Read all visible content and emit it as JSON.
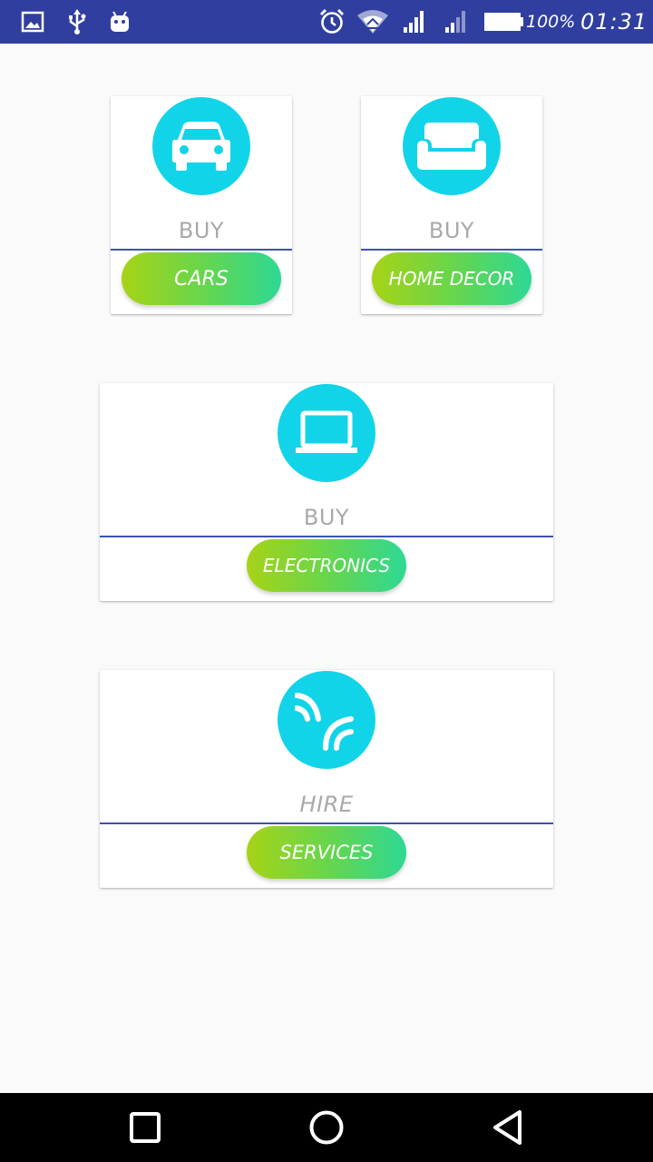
{
  "status_bar": {
    "battery_text": "100%",
    "time": "01:31",
    "icons": [
      "image-icon",
      "usb-icon",
      "android-icon",
      "alarm-icon",
      "wifi-icon",
      "signal-icon",
      "signal-icon",
      "battery-icon"
    ]
  },
  "cards": [
    {
      "icon": "car-icon",
      "verb": "BUY",
      "button_label": "CARS"
    },
    {
      "icon": "sofa-icon",
      "verb": "BUY",
      "button_label": "HOME DECOR"
    },
    {
      "icon": "laptop-icon",
      "verb": "BUY",
      "button_label": "ELECTRONICS"
    },
    {
      "icon": "services-icon",
      "verb": "HIRE",
      "button_label": "SERVICES"
    }
  ],
  "nav_bar": {
    "buttons": [
      "recents-icon",
      "home-icon",
      "back-icon"
    ]
  },
  "colors": {
    "status_bar": "#303f9f",
    "accent_circle": "#12d4e8",
    "divider": "#3f51b5",
    "gradient_start": "#a7d316",
    "gradient_end": "#2ed895",
    "verb_text": "#a9a9a9"
  }
}
